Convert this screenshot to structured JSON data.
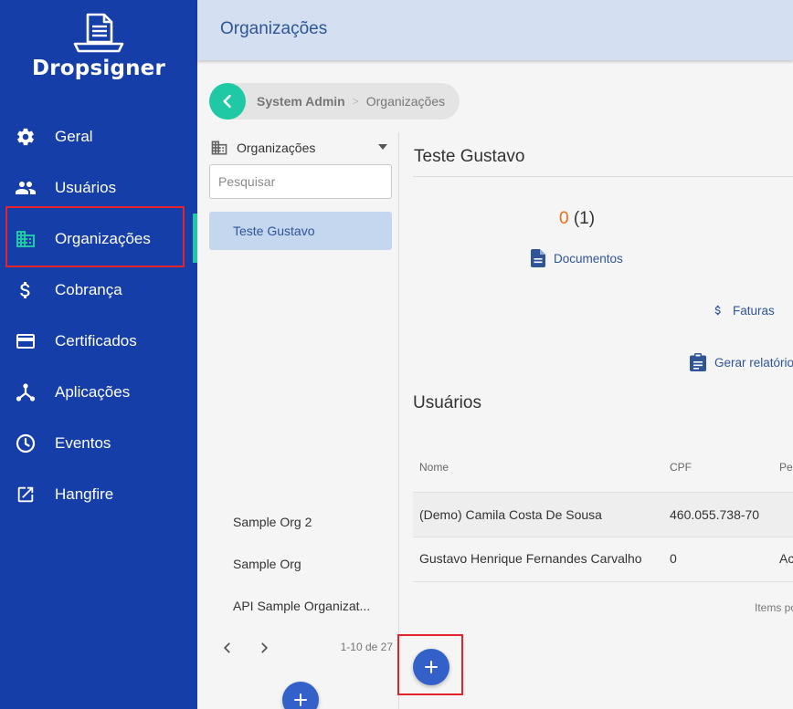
{
  "brand": {
    "name": "Dropsigner"
  },
  "sidebar": {
    "items": [
      {
        "label": "Geral",
        "icon": "gear-icon"
      },
      {
        "label": "Usuários",
        "icon": "people-icon"
      },
      {
        "label": "Organizações",
        "icon": "building-icon",
        "active": true
      },
      {
        "label": "Cobrança",
        "icon": "dollar-icon"
      },
      {
        "label": "Certificados",
        "icon": "credit-card-icon"
      },
      {
        "label": "Aplicações",
        "icon": "hub-icon"
      },
      {
        "label": "Eventos",
        "icon": "clock-icon"
      },
      {
        "label": "Hangfire",
        "icon": "external-link-icon"
      }
    ]
  },
  "header": {
    "title": "Organizações"
  },
  "breadcrumb": {
    "parent": "System Admin",
    "current": "Organizações"
  },
  "org_list": {
    "select_label": "Organizações",
    "search_placeholder": "Pesquisar",
    "selected": "Teste Gustavo",
    "items": [
      "Sample Org 2",
      "Sample Org",
      "API Sample Organizat..."
    ],
    "pager_range": "1-10 de 27"
  },
  "detail": {
    "title": "Teste Gustavo",
    "documents_count": "0",
    "documents_total": "(1)",
    "documents_label": "Documentos",
    "invoices_label": "Faturas",
    "report_label": "Gerar relatório",
    "users_title": "Usuários",
    "table": {
      "columns": [
        "Nome",
        "CPF",
        "Pe"
      ],
      "rows": [
        {
          "name": "(Demo) Camila Costa De Sousa",
          "cpf": "460.055.738-70",
          "extra": ""
        },
        {
          "name": "Gustavo Henrique Fernandes Carvalho",
          "cpf": "0",
          "extra": "Ac"
        }
      ]
    },
    "items_per_page_label": "Items po"
  },
  "colors": {
    "sidebar_bg": "#153ea8",
    "accent_teal": "#20c9a6",
    "header_bg": "#d4e0f2",
    "link_blue": "#2f5597",
    "count_orange": "#ef6c1a",
    "highlight_red": "#e4232b",
    "fab_blue": "#3361c9"
  }
}
